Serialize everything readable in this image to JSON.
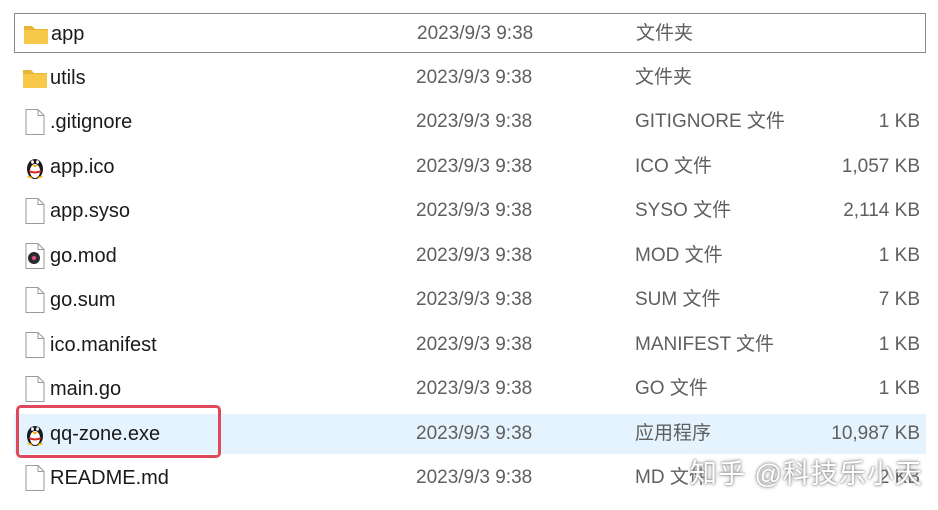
{
  "files": [
    {
      "name": "app",
      "date": "2023/9/3 9:38",
      "type": "文件夹",
      "size": "",
      "icon": "folder-icon",
      "state": "focused"
    },
    {
      "name": "utils",
      "date": "2023/9/3 9:38",
      "type": "文件夹",
      "size": "",
      "icon": "folder-icon",
      "state": ""
    },
    {
      "name": ".gitignore",
      "date": "2023/9/3 9:38",
      "type": "GITIGNORE 文件",
      "size": "1 KB",
      "icon": "file-icon",
      "state": ""
    },
    {
      "name": "app.ico",
      "date": "2023/9/3 9:38",
      "type": "ICO 文件",
      "size": "1,057 KB",
      "icon": "penguin-icon",
      "state": ""
    },
    {
      "name": "app.syso",
      "date": "2023/9/3 9:38",
      "type": "SYSO 文件",
      "size": "2,114 KB",
      "icon": "file-icon",
      "state": ""
    },
    {
      "name": "go.mod",
      "date": "2023/9/3 9:38",
      "type": "MOD 文件",
      "size": "1 KB",
      "icon": "media-file-icon",
      "state": ""
    },
    {
      "name": "go.sum",
      "date": "2023/9/3 9:38",
      "type": "SUM 文件",
      "size": "7 KB",
      "icon": "file-icon",
      "state": ""
    },
    {
      "name": "ico.manifest",
      "date": "2023/9/3 9:38",
      "type": "MANIFEST 文件",
      "size": "1 KB",
      "icon": "file-icon",
      "state": ""
    },
    {
      "name": "main.go",
      "date": "2023/9/3 9:38",
      "type": "GO 文件",
      "size": "1 KB",
      "icon": "file-icon",
      "state": ""
    },
    {
      "name": "qq-zone.exe",
      "date": "2023/9/3 9:38",
      "type": "应用程序",
      "size": "10,987 KB",
      "icon": "penguin-icon",
      "state": "selected"
    },
    {
      "name": "README.md",
      "date": "2023/9/3 9:38",
      "type": "MD 文件",
      "size": "2 KB",
      "icon": "file-icon",
      "state": ""
    }
  ],
  "watermark": "知乎 @科技乐小天",
  "colors": {
    "selected_row": "#e5f3ff",
    "highlight_box": "#e0495b",
    "folder": "#f8c84a"
  }
}
